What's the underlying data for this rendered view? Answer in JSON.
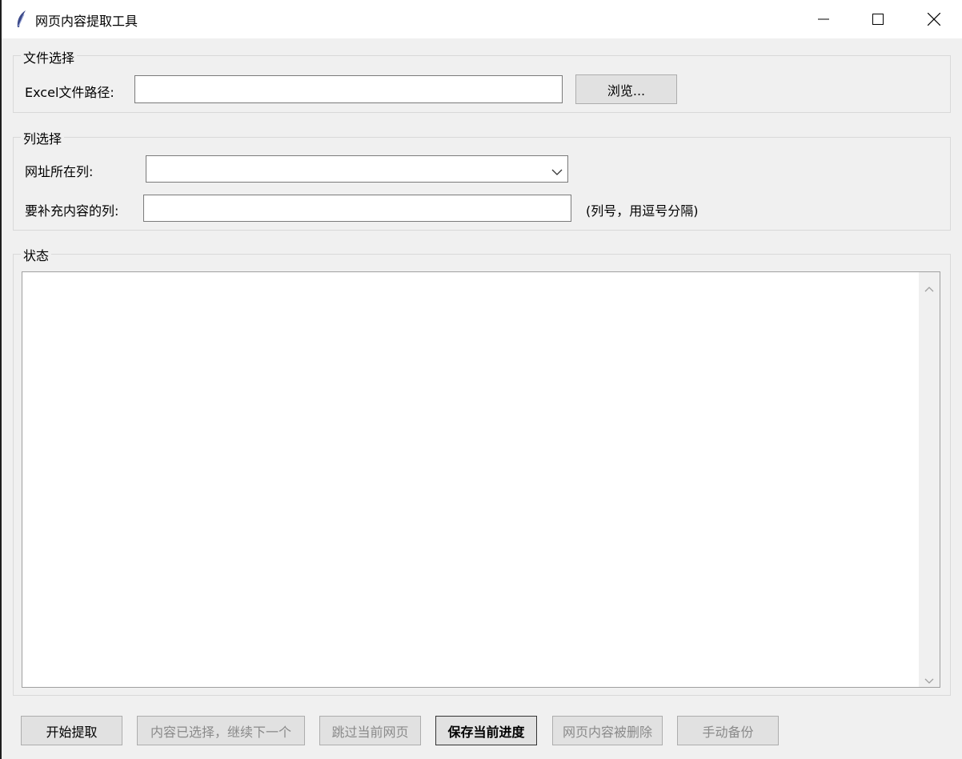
{
  "window": {
    "title": "网页内容提取工具"
  },
  "file_group": {
    "title": "文件选择",
    "path_label": "Excel文件路径:",
    "path_value": "",
    "browse_label": "浏览..."
  },
  "column_group": {
    "title": "列选择",
    "url_col_label": "网址所在列:",
    "url_col_value": "",
    "fill_cols_label": "要补充内容的列:",
    "fill_cols_value": "",
    "fill_cols_hint": "(列号，用逗号分隔)"
  },
  "status_group": {
    "title": "状态",
    "log_text": ""
  },
  "actions": {
    "start": "开始提取",
    "next": "内容已选择，继续下一个",
    "skip": "跳过当前网页",
    "save": "保存当前进度",
    "deleted": "网页内容被删除",
    "backup": "手动备份"
  }
}
